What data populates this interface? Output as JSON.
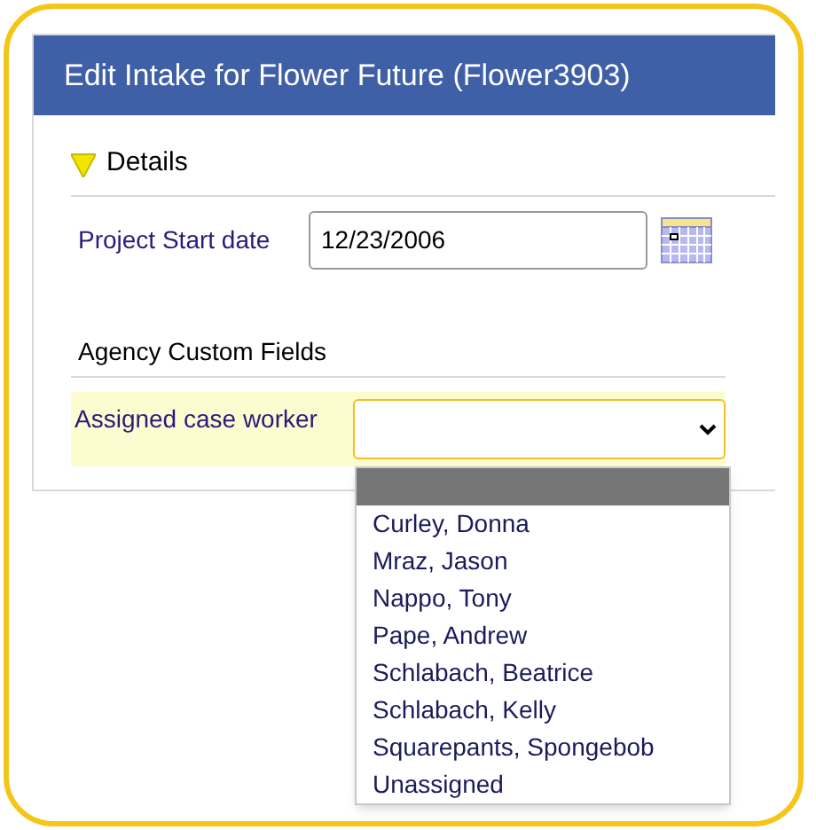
{
  "dialog": {
    "title": "Edit Intake for Flower Future (Flower3903)"
  },
  "section": {
    "title": "Details",
    "expanded": true
  },
  "start_date": {
    "label": "Project Start date",
    "value": "12/23/2006"
  },
  "custom_fields": {
    "title": "Agency Custom Fields"
  },
  "case_worker": {
    "label": "Assigned case worker",
    "focused": true,
    "open": true,
    "options": [
      {
        "selected": true
      },
      {
        "label": "Curley, Donna",
        "selected": false
      },
      {
        "label": "Mraz, Jason",
        "selected": false
      },
      {
        "label": "Nappo, Tony",
        "selected": false
      },
      {
        "label": "Pape, Andrew",
        "selected": false
      },
      {
        "label": "Schlabach, Beatrice",
        "selected": false
      },
      {
        "label": "Schlabach, Kelly",
        "selected": false
      },
      {
        "label": "Squarepants, Spongebob",
        "selected": false
      },
      {
        "label": "Unassigned",
        "selected": false
      }
    ]
  }
}
